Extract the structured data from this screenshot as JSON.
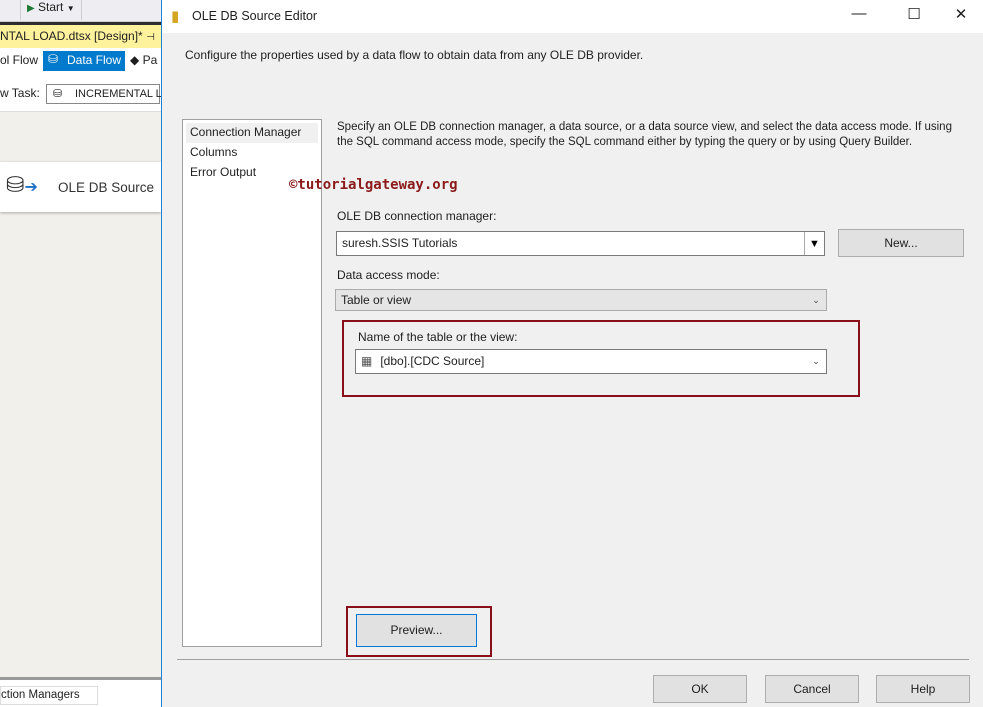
{
  "background_app": {
    "start_label": "Start",
    "doc_tab": "NTAL LOAD.dtsx [Design]*",
    "tabs": [
      "ol Flow",
      "Data Flow",
      "Pa"
    ],
    "task_label": "w Task:",
    "task_value": "INCREMENTAL LO",
    "component": "OLE DB Source",
    "bottom_tab": "ction Managers"
  },
  "dialog": {
    "title": "OLE DB Source Editor",
    "description": "Configure the properties used by a data flow to obtain data from any OLE DB provider.",
    "nav": [
      "Connection Manager",
      "Columns",
      "Error Output"
    ],
    "instructions": [
      "Specify an OLE DB connection manager, a data source, or a data source view, and select the data access mode. If using",
      "the SQL command access mode, specify the SQL command either by typing the query or by using Query Builder."
    ],
    "watermark": "©tutorialgateway.org",
    "conn_label": "OLE DB connection manager:",
    "conn_value": "suresh.SSIS Tutorials",
    "new_button": "New...",
    "mode_label": "Data access mode:",
    "mode_value": "Table or view",
    "table_label": "Name of the table or the view:",
    "table_value": "[dbo].[CDC Source]",
    "preview_button": "Preview...",
    "ok": "OK",
    "cancel": "Cancel",
    "help": "Help",
    "highlight_color": "#8b0f1a"
  }
}
